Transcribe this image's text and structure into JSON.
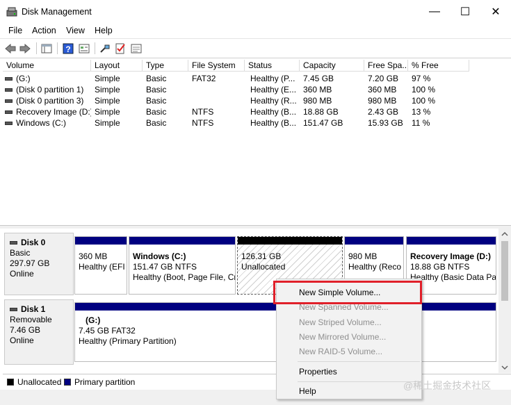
{
  "window": {
    "title": "Disk Management",
    "minimize": "—",
    "maximize": "☐",
    "close": "✕"
  },
  "menu": [
    "File",
    "Action",
    "View",
    "Help"
  ],
  "columns": [
    "Volume",
    "Layout",
    "Type",
    "File System",
    "Status",
    "Capacity",
    "Free Spa...",
    "% Free"
  ],
  "volumes": [
    {
      "volume": "(G:)",
      "layout": "Simple",
      "type": "Basic",
      "fs": "FAT32",
      "status": "Healthy (P...",
      "capacity": "7.45 GB",
      "free": "7.20 GB",
      "pct": "97 %"
    },
    {
      "volume": "(Disk 0 partition 1)",
      "layout": "Simple",
      "type": "Basic",
      "fs": "",
      "status": "Healthy (E...",
      "capacity": "360 MB",
      "free": "360 MB",
      "pct": "100 %"
    },
    {
      "volume": "(Disk 0 partition 3)",
      "layout": "Simple",
      "type": "Basic",
      "fs": "",
      "status": "Healthy (R...",
      "capacity": "980 MB",
      "free": "980 MB",
      "pct": "100 %"
    },
    {
      "volume": "Recovery Image (D:)",
      "layout": "Simple",
      "type": "Basic",
      "fs": "NTFS",
      "status": "Healthy (B...",
      "capacity": "18.88 GB",
      "free": "2.43 GB",
      "pct": "13 %"
    },
    {
      "volume": "Windows (C:)",
      "layout": "Simple",
      "type": "Basic",
      "fs": "NTFS",
      "status": "Healthy (B...",
      "capacity": "151.47 GB",
      "free": "15.93 GB",
      "pct": "11 %"
    }
  ],
  "disk0": {
    "name": "Disk 0",
    "type": "Basic",
    "size": "297.97 GB",
    "state": "Online",
    "partitions": [
      {
        "line1": "",
        "line2": "360 MB",
        "line3": "Healthy (EFI"
      },
      {
        "line1": "Windows  (C:)",
        "line2": "151.47 GB NTFS",
        "line3": "Healthy (Boot, Page File, Cr"
      },
      {
        "line1": "",
        "line2": "126.31 GB",
        "line3": "Unallocated"
      },
      {
        "line1": "",
        "line2": "980 MB",
        "line3": "Healthy (Reco"
      },
      {
        "line1": "Recovery Image  (D:)",
        "line2": "18.88 GB NTFS",
        "line3": "Healthy (Basic Data Pa"
      }
    ]
  },
  "disk1": {
    "name": "Disk 1",
    "type": "Removable",
    "size": "7.46 GB",
    "state": "Online",
    "partition": {
      "line1": "(G:)",
      "line2": "7.45 GB FAT32",
      "line3": "Healthy (Primary Partition)"
    }
  },
  "legend": {
    "unallocated": "Unallocated",
    "primary": "Primary partition"
  },
  "context_menu": {
    "new_simple": "New Simple Volume...",
    "new_spanned": "New Spanned Volume...",
    "new_striped": "New Striped Volume...",
    "new_mirrored": "New Mirrored Volume...",
    "new_raid5": "New RAID-5 Volume...",
    "properties": "Properties",
    "help": "Help"
  },
  "watermark": "@稀土掘金技术社区",
  "colors": {
    "primary_partition": "#000080",
    "unallocated": "#000000",
    "highlight": "#e0202a"
  }
}
